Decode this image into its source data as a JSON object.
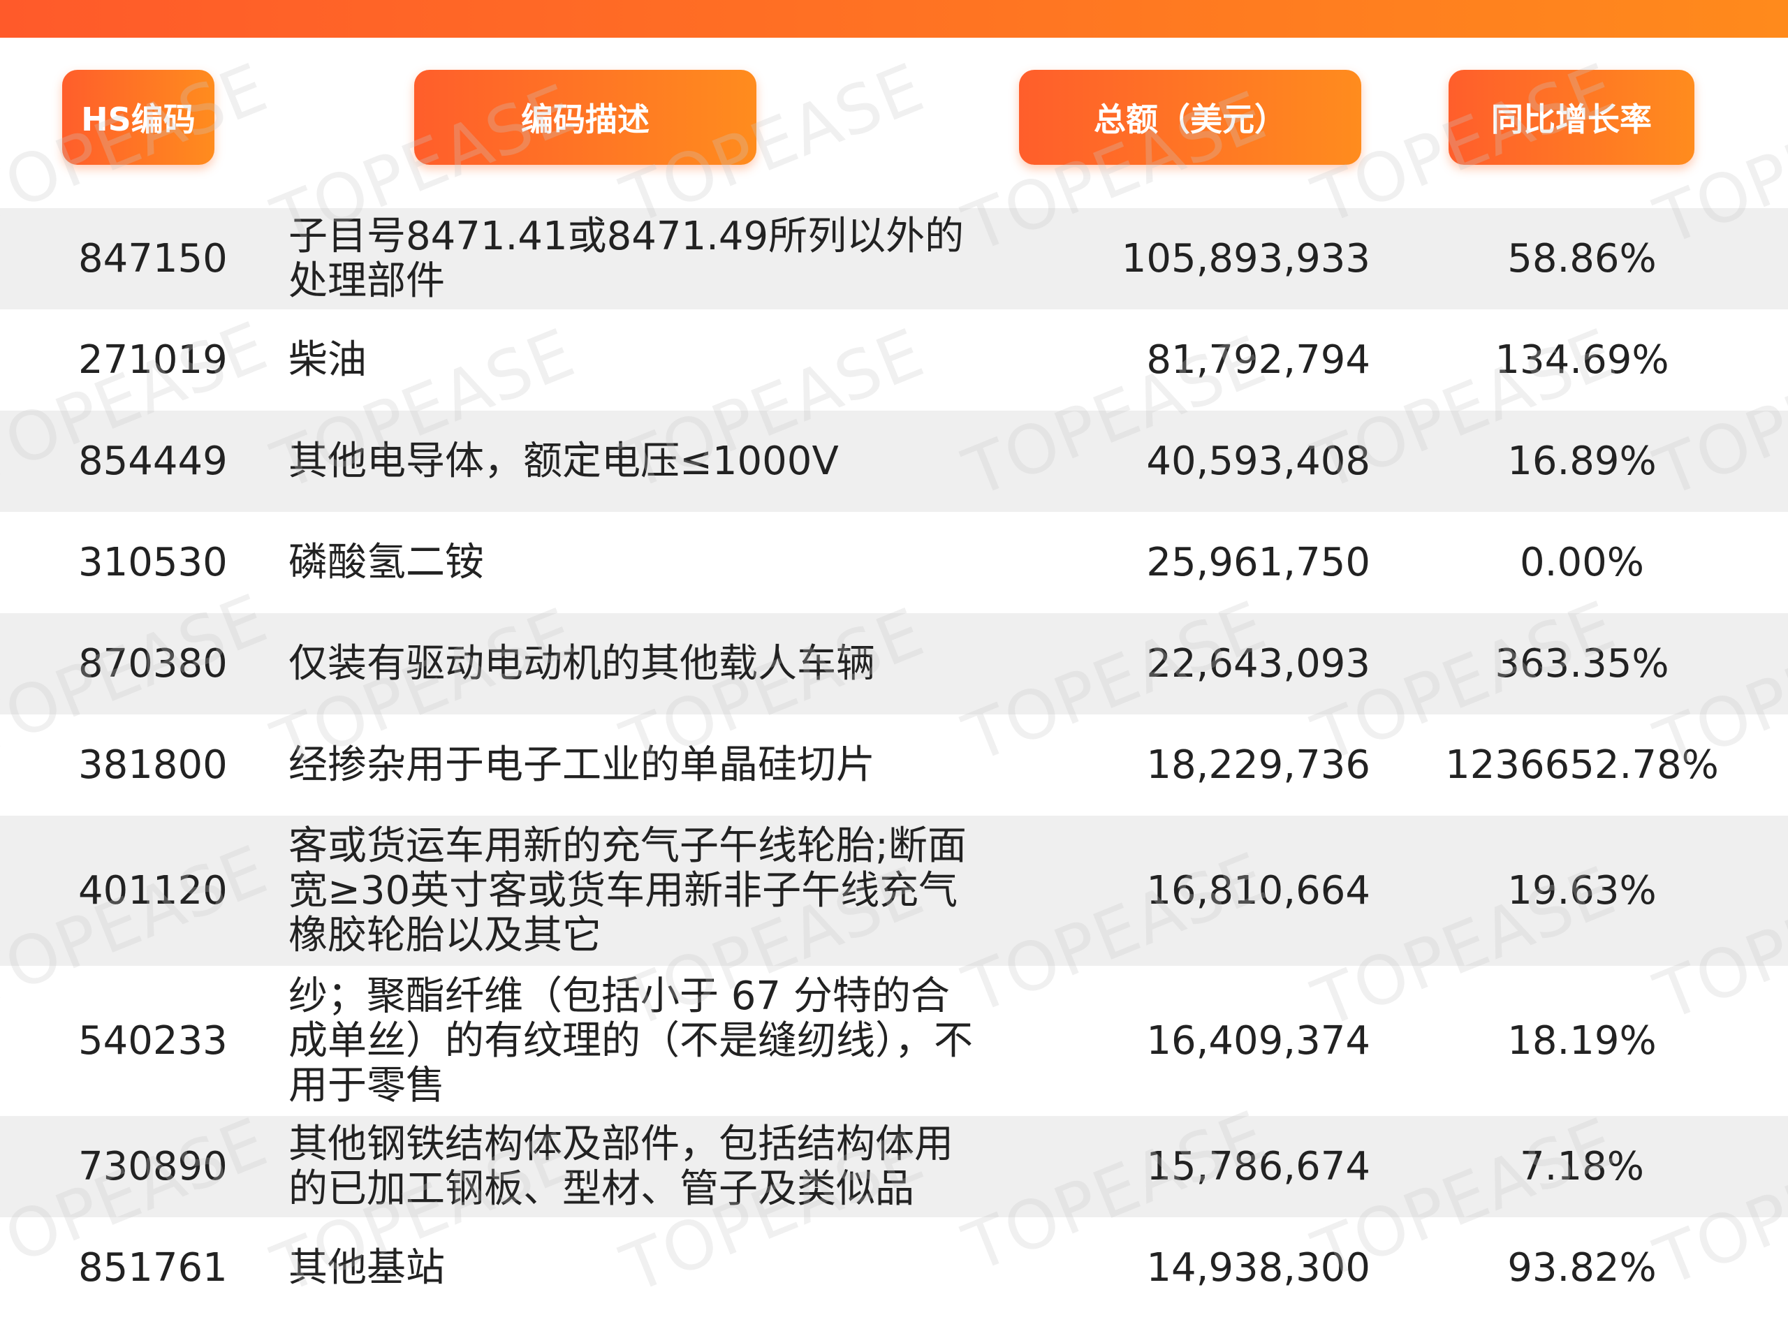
{
  "header": {
    "hs_code": "HS编码",
    "description": "编码描述",
    "total": "总额（美元）",
    "growth": "同比增长率"
  },
  "watermark_text": "TOPEASE",
  "colors": {
    "accent_start": "#ff5e2b",
    "accent_end": "#ff8c1e",
    "row_shade": "#efefef",
    "text": "#222222"
  },
  "rows": [
    {
      "code": "847150",
      "description": "子目号8471.41或8471.49所列以外的处理部件",
      "total": "105,893,933",
      "growth": "58.86%"
    },
    {
      "code": "271019",
      "description": "柴油",
      "total": "81,792,794",
      "growth": "134.69%"
    },
    {
      "code": "854449",
      "description": "其他电导体，额定电压≤1000V",
      "total": "40,593,408",
      "growth": "16.89%"
    },
    {
      "code": "310530",
      "description": "磷酸氢二铵",
      "total": "25,961,750",
      "growth": "0.00%"
    },
    {
      "code": "870380",
      "description": "仅装有驱动电动机的其他载人车辆",
      "total": "22,643,093",
      "growth": "363.35%"
    },
    {
      "code": "381800",
      "description": "经掺杂用于电子工业的单晶硅切片",
      "total": "18,229,736",
      "growth": "1236652.78%"
    },
    {
      "code": "401120",
      "description": "客或货运车用新的充气子午线轮胎;断面宽≥30英寸客或货车用新非子午线充气橡胶轮胎以及其它",
      "total": "16,810,664",
      "growth": "19.63%"
    },
    {
      "code": "540233",
      "description": "纱；聚酯纤维（包括小于 67 分特的合成单丝）的有纹理的（不是缝纫线），不用于零售",
      "total": "16,409,374",
      "growth": "18.19%"
    },
    {
      "code": "730890",
      "description": "其他钢铁结构体及部件，包括结构体用的已加工钢板、型材、管子及类似品",
      "total": "15,786,674",
      "growth": "7.18%"
    },
    {
      "code": "851761",
      "description": "其他基站",
      "total": "14,938,300",
      "growth": "93.82%"
    }
  ]
}
